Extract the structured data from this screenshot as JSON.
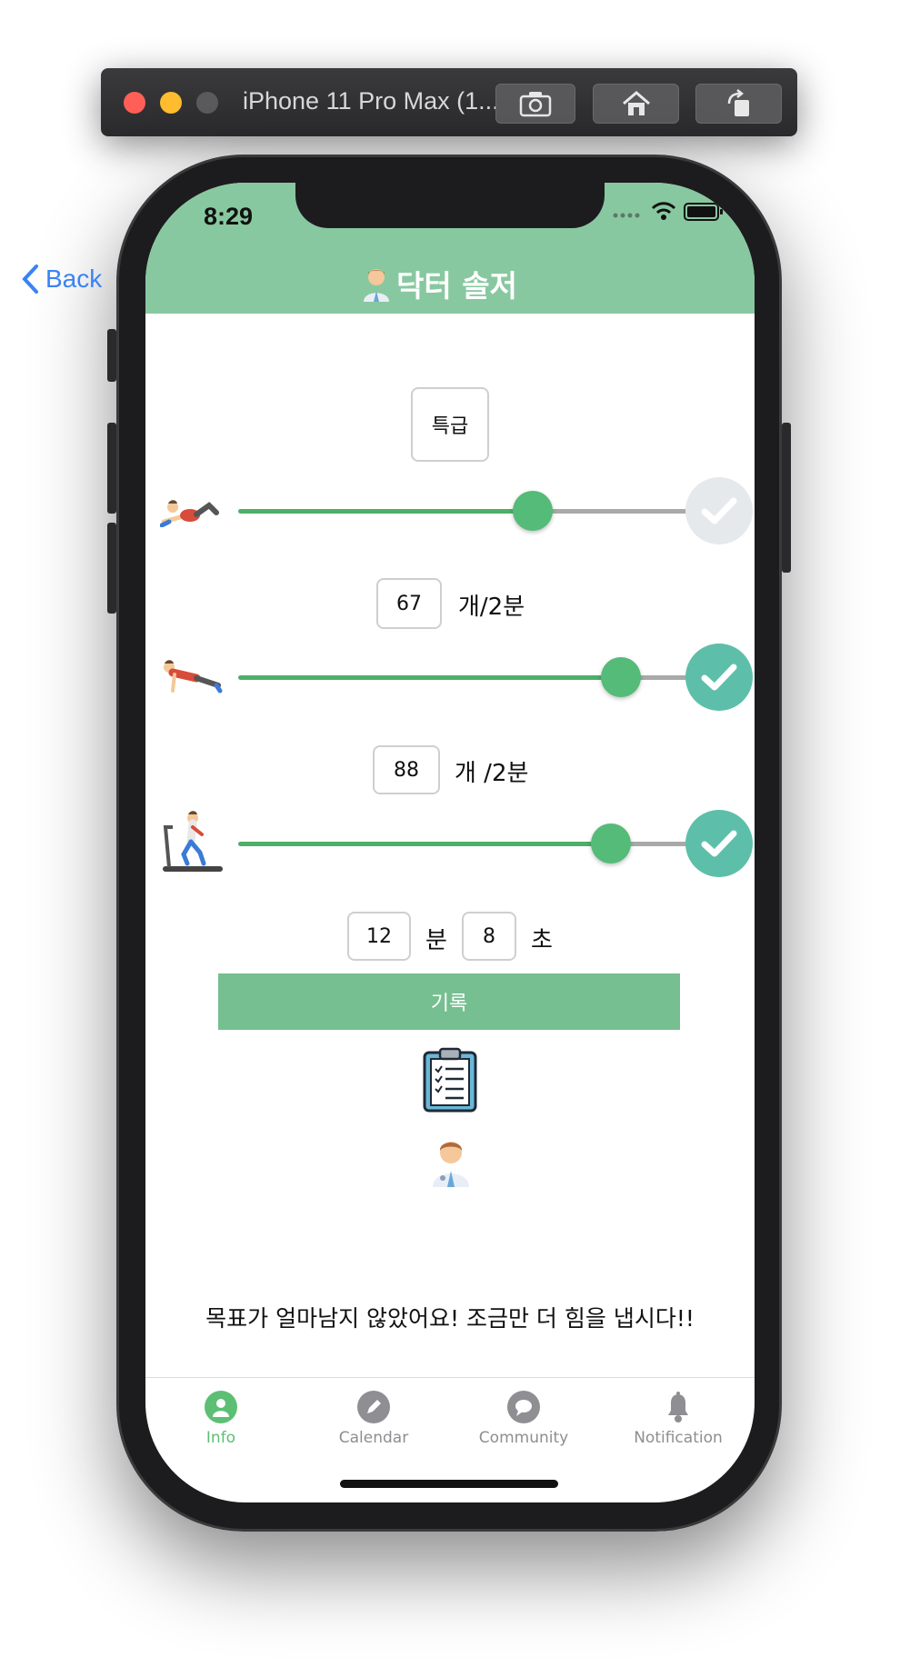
{
  "simulator": {
    "title": "iPhone 11 Pro Max (1...",
    "buttons": [
      "screenshot-icon",
      "home-icon",
      "rotate-icon"
    ]
  },
  "status_bar": {
    "time": "8:29"
  },
  "nav": {
    "back_label": "Back",
    "title": "닥터 솔저"
  },
  "grade_label": "특급",
  "exercises": [
    {
      "name": "situp",
      "icon": "situp-icon",
      "slider_fraction": 0.65,
      "completed": false
    },
    {
      "name": "pushup",
      "icon": "pushup-icon",
      "count": "67",
      "unit": "개/2분",
      "slider_fraction": 0.85,
      "completed": true
    },
    {
      "name": "running",
      "icon": "treadmill-icon",
      "count": "88",
      "unit": "개 /2분",
      "slider_fraction": 0.83,
      "completed": true
    }
  ],
  "time_entry": {
    "minutes": "12",
    "minutes_unit": "분",
    "seconds": "8",
    "seconds_unit": "초"
  },
  "record_button": "기록",
  "message": "목표가 얼마남지 않았어요! 조금만 더 힘을 냅시다!!",
  "tabs": [
    {
      "label": "Info",
      "icon": "person-icon",
      "active": true
    },
    {
      "label": "Calendar",
      "icon": "pencil-icon",
      "active": false
    },
    {
      "label": "Community",
      "icon": "chat-icon",
      "active": false
    },
    {
      "label": "Notification",
      "icon": "bell-icon",
      "active": false
    }
  ],
  "colors": {
    "header": "#88c8a0",
    "slider_fill": "#4caf6a",
    "thumb": "#55bb78",
    "check_active": "#5dbfa9",
    "check_inactive": "#e6e9ec",
    "tab_active": "#5cbf74",
    "tab_inactive": "#8e8e93",
    "back_link": "#3a82f6"
  }
}
